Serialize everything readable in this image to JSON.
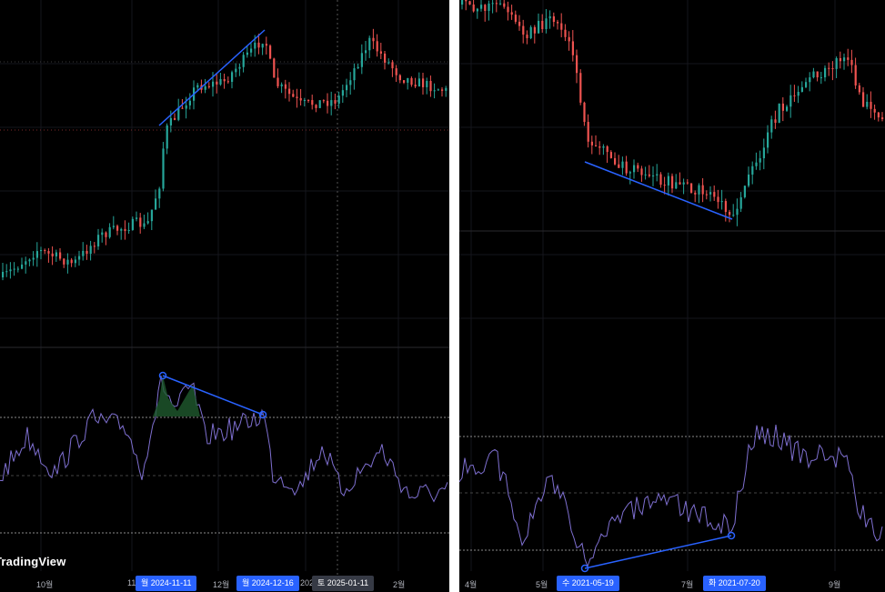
{
  "watermark": "TradingView",
  "colors": {
    "up": "#26a69a",
    "down": "#ef5350",
    "drawing": "#2962ff",
    "rsi": "#7e6fd0",
    "bg": "#000000"
  },
  "left": {
    "axis_labels": [
      "10월",
      "11",
      "12월",
      "202",
      "2월"
    ],
    "badges": [
      {
        "label": "월 2024-11-11",
        "style": "blue"
      },
      {
        "label": "월 2024-12-16",
        "style": "blue"
      },
      {
        "label": "토 2025-01-11",
        "style": "dark"
      }
    ],
    "price_trendline": "rising line on price highs",
    "rsi_trendline": "falling line on RSI highs"
  },
  "right": {
    "axis_labels": [
      "4월",
      "5월",
      "7월",
      "9월"
    ],
    "badges": [
      {
        "label": "수 2021-05-19",
        "style": "blue"
      },
      {
        "label": "화 2021-07-20",
        "style": "blue"
      }
    ],
    "price_trendline": "falling line on price lows",
    "rsi_trendline": "rising line on RSI lows"
  }
}
